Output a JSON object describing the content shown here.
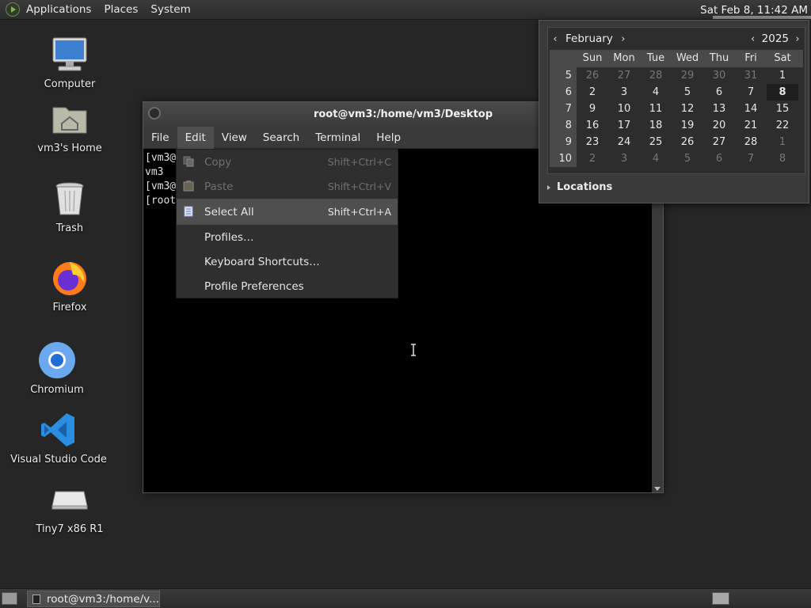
{
  "top_panel": {
    "applications": "Applications",
    "places": "Places",
    "system": "System",
    "clock": "Sat Feb  8, 11:42 AM"
  },
  "desktop_icons": [
    {
      "label": "Computer",
      "icon": "computer-icon"
    },
    {
      "label": "vm3's Home",
      "icon": "home-folder-icon"
    },
    {
      "label": "Trash",
      "icon": "trash-icon"
    },
    {
      "label": "Firefox",
      "icon": "firefox-icon"
    },
    {
      "label": "Chromium",
      "icon": "chromium-icon"
    },
    {
      "label": "Visual Studio Code",
      "icon": "vscode-icon"
    },
    {
      "label": "Tiny7 x86 R1",
      "icon": "drive-icon"
    }
  ],
  "terminal": {
    "title": "root@vm3:/home/vm3/Desktop",
    "menus": [
      "File",
      "Edit",
      "View",
      "Search",
      "Terminal",
      "Help"
    ],
    "lines": [
      "[vm3@",
      "vm3",
      "[vm3@",
      "[root"
    ]
  },
  "edit_menu": {
    "items": [
      {
        "label": "Copy",
        "accel": "Shift+Ctrl+C",
        "enabled": false,
        "icon": "copy-icon"
      },
      {
        "label": "Paste",
        "accel": "Shift+Ctrl+V",
        "enabled": false,
        "icon": "paste-icon"
      },
      {
        "label": "Select All",
        "accel": "Shift+Ctrl+A",
        "enabled": true,
        "icon": "select-all-icon"
      },
      {
        "label": "Profiles…",
        "accel": "",
        "enabled": true
      },
      {
        "label": "Keyboard Shortcuts…",
        "accel": "",
        "enabled": true
      },
      {
        "label": "Profile Preferences",
        "accel": "",
        "enabled": true
      }
    ]
  },
  "calendar": {
    "month": "February",
    "year": "2025",
    "day_headers": [
      "Sun",
      "Mon",
      "Tue",
      "Wed",
      "Thu",
      "Fri",
      "Sat"
    ],
    "weeks": [
      {
        "wk": "5",
        "days": [
          "26",
          "27",
          "28",
          "29",
          "30",
          "31",
          "1"
        ]
      },
      {
        "wk": "6",
        "days": [
          "2",
          "3",
          "4",
          "5",
          "6",
          "7",
          "8"
        ]
      },
      {
        "wk": "7",
        "days": [
          "9",
          "10",
          "11",
          "12",
          "13",
          "14",
          "15"
        ]
      },
      {
        "wk": "8",
        "days": [
          "16",
          "17",
          "18",
          "19",
          "20",
          "21",
          "22"
        ]
      },
      {
        "wk": "9",
        "days": [
          "23",
          "24",
          "25",
          "26",
          "27",
          "28",
          "1"
        ]
      },
      {
        "wk": "10",
        "days": [
          "2",
          "3",
          "4",
          "5",
          "6",
          "7",
          "8"
        ]
      }
    ],
    "today": "8",
    "locations": "Locations"
  },
  "bottom_panel": {
    "task_label": "root@vm3:/home/v..."
  }
}
